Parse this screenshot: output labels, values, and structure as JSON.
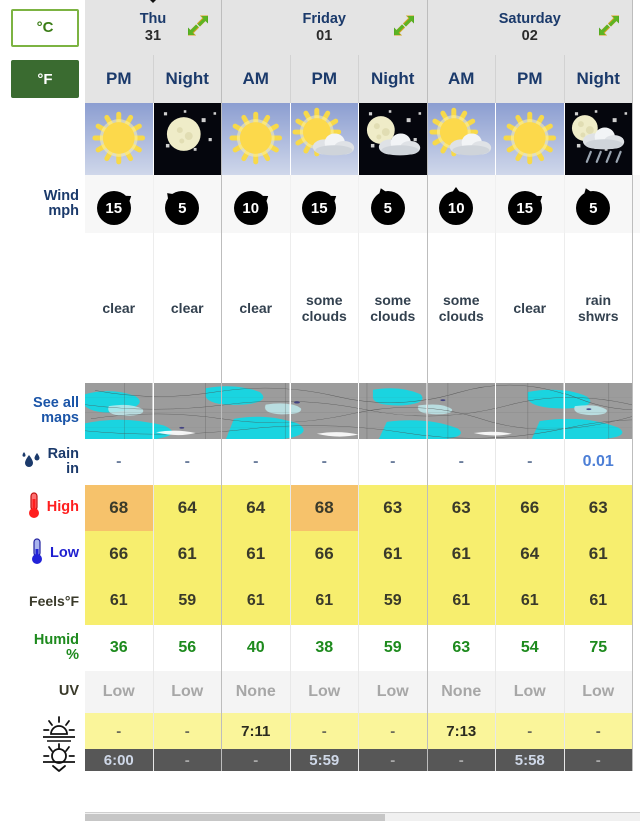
{
  "units": {
    "celsius_label": "°C",
    "fahrenheit_label": "°F",
    "selected": "°F"
  },
  "row_labels": {
    "wind": "Wind",
    "wind_unit": "mph",
    "maps": "See all",
    "maps2": "maps",
    "rain": "Rain",
    "rain_unit": "in",
    "high": "High",
    "low": "Low",
    "feels": "Feels°F",
    "humid": "Humid",
    "humid_unit": "%",
    "uv": "UV",
    "sunrise": "sunrise-icon",
    "sunset": "sunset-icon"
  },
  "days": [
    {
      "name": "Thu",
      "date": "31",
      "periods": [
        "PM",
        "Night"
      ]
    },
    {
      "name": "Friday",
      "date": "01",
      "periods": [
        "AM",
        "PM",
        "Night"
      ]
    },
    {
      "name": "Saturday",
      "date": "02",
      "periods": [
        "AM",
        "PM",
        "Night"
      ]
    }
  ],
  "columns": [
    {
      "day": "Thu",
      "period": "PM",
      "day_index": 0,
      "last_of_day": false,
      "icon": "sun",
      "night": false,
      "wind_speed": "15",
      "wind_dir_deg": 55,
      "condition": "clear",
      "rain": "-",
      "rain_is_value": false,
      "high": "68",
      "high_hot": true,
      "low": "66",
      "feels": "61",
      "humidity": "36",
      "uv": "Low",
      "sunrise": "-",
      "sunset": "6:00"
    },
    {
      "day": "Thu",
      "period": "Night",
      "day_index": 0,
      "last_of_day": true,
      "icon": "moon-stars",
      "night": true,
      "wind_speed": "5",
      "wind_dir_deg": 315,
      "condition": "clear",
      "rain": "-",
      "rain_is_value": false,
      "high": "64",
      "high_hot": false,
      "low": "61",
      "feels": "59",
      "humidity": "56",
      "uv": "Low",
      "sunrise": "-",
      "sunset": "-"
    },
    {
      "day": "Friday",
      "period": "AM",
      "day_index": 1,
      "last_of_day": false,
      "icon": "sun",
      "night": false,
      "wind_speed": "10",
      "wind_dir_deg": 55,
      "condition": "clear",
      "rain": "-",
      "rain_is_value": false,
      "high": "64",
      "high_hot": false,
      "low": "61",
      "feels": "61",
      "humidity": "40",
      "uv": "None",
      "sunrise": "7:11",
      "sunset": "-"
    },
    {
      "day": "Friday",
      "period": "PM",
      "day_index": 1,
      "last_of_day": false,
      "icon": "sun-cloud",
      "night": false,
      "wind_speed": "15",
      "wind_dir_deg": 55,
      "condition": "some clouds",
      "rain": "-",
      "rain_is_value": false,
      "high": "68",
      "high_hot": true,
      "low": "66",
      "feels": "61",
      "humidity": "38",
      "uv": "Low",
      "sunrise": "-",
      "sunset": "5:59"
    },
    {
      "day": "Friday",
      "period": "Night",
      "day_index": 1,
      "last_of_day": true,
      "icon": "moon-cloud",
      "night": true,
      "wind_speed": "5",
      "wind_dir_deg": 340,
      "condition": "some clouds",
      "rain": "-",
      "rain_is_value": false,
      "high": "63",
      "high_hot": false,
      "low": "61",
      "feels": "59",
      "humidity": "59",
      "uv": "Low",
      "sunrise": "-",
      "sunset": "-"
    },
    {
      "day": "Saturday",
      "period": "AM",
      "day_index": 2,
      "last_of_day": false,
      "icon": "sun-cloud",
      "night": false,
      "wind_speed": "10",
      "wind_dir_deg": 0,
      "condition": "some clouds",
      "rain": "-",
      "rain_is_value": false,
      "high": "63",
      "high_hot": false,
      "low": "61",
      "feels": "61",
      "humidity": "63",
      "uv": "None",
      "sunrise": "7:13",
      "sunset": "-"
    },
    {
      "day": "Saturday",
      "period": "PM",
      "day_index": 2,
      "last_of_day": false,
      "icon": "sun",
      "night": false,
      "wind_speed": "15",
      "wind_dir_deg": 55,
      "condition": "clear",
      "rain": "-",
      "rain_is_value": false,
      "high": "66",
      "high_hot": false,
      "low": "64",
      "feels": "61",
      "humidity": "54",
      "uv": "Low",
      "sunrise": "-",
      "sunset": "5:58"
    },
    {
      "day": "Saturday",
      "period": "Night",
      "day_index": 2,
      "last_of_day": true,
      "icon": "moon-cloud-rain",
      "night": true,
      "wind_speed": "5",
      "wind_dir_deg": 340,
      "condition": "rain shwrs",
      "rain": "0.01",
      "rain_is_value": true,
      "high": "63",
      "high_hot": false,
      "low": "61",
      "feels": "61",
      "humidity": "75",
      "uv": "Low",
      "sunrise": "-",
      "sunset": "-"
    }
  ],
  "colors": {
    "header_bg": "#e4e4e4",
    "temp_yellow": "#f7ee6e",
    "temp_orange": "#f6c26b",
    "sunrise_yellow": "#faf59a",
    "sunset_gray": "#575757",
    "humid_green": "#1d8a1d",
    "rain_blue": "#4d7fd6",
    "high_red": "#ff1f1f",
    "low_blue": "#1f1fd0",
    "accent_green": "#3a6b30"
  }
}
